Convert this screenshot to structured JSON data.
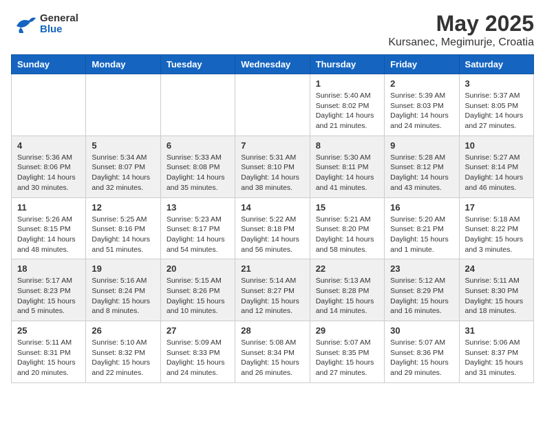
{
  "header": {
    "logo_general": "General",
    "logo_blue": "Blue",
    "title": "May 2025",
    "subtitle": "Kursanec, Megimurje, Croatia"
  },
  "weekdays": [
    "Sunday",
    "Monday",
    "Tuesday",
    "Wednesday",
    "Thursday",
    "Friday",
    "Saturday"
  ],
  "weeks": [
    [
      {
        "day": "",
        "info": ""
      },
      {
        "day": "",
        "info": ""
      },
      {
        "day": "",
        "info": ""
      },
      {
        "day": "",
        "info": ""
      },
      {
        "day": "1",
        "info": "Sunrise: 5:40 AM\nSunset: 8:02 PM\nDaylight: 14 hours\nand 21 minutes."
      },
      {
        "day": "2",
        "info": "Sunrise: 5:39 AM\nSunset: 8:03 PM\nDaylight: 14 hours\nand 24 minutes."
      },
      {
        "day": "3",
        "info": "Sunrise: 5:37 AM\nSunset: 8:05 PM\nDaylight: 14 hours\nand 27 minutes."
      }
    ],
    [
      {
        "day": "4",
        "info": "Sunrise: 5:36 AM\nSunset: 8:06 PM\nDaylight: 14 hours\nand 30 minutes."
      },
      {
        "day": "5",
        "info": "Sunrise: 5:34 AM\nSunset: 8:07 PM\nDaylight: 14 hours\nand 32 minutes."
      },
      {
        "day": "6",
        "info": "Sunrise: 5:33 AM\nSunset: 8:08 PM\nDaylight: 14 hours\nand 35 minutes."
      },
      {
        "day": "7",
        "info": "Sunrise: 5:31 AM\nSunset: 8:10 PM\nDaylight: 14 hours\nand 38 minutes."
      },
      {
        "day": "8",
        "info": "Sunrise: 5:30 AM\nSunset: 8:11 PM\nDaylight: 14 hours\nand 41 minutes."
      },
      {
        "day": "9",
        "info": "Sunrise: 5:28 AM\nSunset: 8:12 PM\nDaylight: 14 hours\nand 43 minutes."
      },
      {
        "day": "10",
        "info": "Sunrise: 5:27 AM\nSunset: 8:14 PM\nDaylight: 14 hours\nand 46 minutes."
      }
    ],
    [
      {
        "day": "11",
        "info": "Sunrise: 5:26 AM\nSunset: 8:15 PM\nDaylight: 14 hours\nand 48 minutes."
      },
      {
        "day": "12",
        "info": "Sunrise: 5:25 AM\nSunset: 8:16 PM\nDaylight: 14 hours\nand 51 minutes."
      },
      {
        "day": "13",
        "info": "Sunrise: 5:23 AM\nSunset: 8:17 PM\nDaylight: 14 hours\nand 54 minutes."
      },
      {
        "day": "14",
        "info": "Sunrise: 5:22 AM\nSunset: 8:18 PM\nDaylight: 14 hours\nand 56 minutes."
      },
      {
        "day": "15",
        "info": "Sunrise: 5:21 AM\nSunset: 8:20 PM\nDaylight: 14 hours\nand 58 minutes."
      },
      {
        "day": "16",
        "info": "Sunrise: 5:20 AM\nSunset: 8:21 PM\nDaylight: 15 hours\nand 1 minute."
      },
      {
        "day": "17",
        "info": "Sunrise: 5:18 AM\nSunset: 8:22 PM\nDaylight: 15 hours\nand 3 minutes."
      }
    ],
    [
      {
        "day": "18",
        "info": "Sunrise: 5:17 AM\nSunset: 8:23 PM\nDaylight: 15 hours\nand 5 minutes."
      },
      {
        "day": "19",
        "info": "Sunrise: 5:16 AM\nSunset: 8:24 PM\nDaylight: 15 hours\nand 8 minutes."
      },
      {
        "day": "20",
        "info": "Sunrise: 5:15 AM\nSunset: 8:26 PM\nDaylight: 15 hours\nand 10 minutes."
      },
      {
        "day": "21",
        "info": "Sunrise: 5:14 AM\nSunset: 8:27 PM\nDaylight: 15 hours\nand 12 minutes."
      },
      {
        "day": "22",
        "info": "Sunrise: 5:13 AM\nSunset: 8:28 PM\nDaylight: 15 hours\nand 14 minutes."
      },
      {
        "day": "23",
        "info": "Sunrise: 5:12 AM\nSunset: 8:29 PM\nDaylight: 15 hours\nand 16 minutes."
      },
      {
        "day": "24",
        "info": "Sunrise: 5:11 AM\nSunset: 8:30 PM\nDaylight: 15 hours\nand 18 minutes."
      }
    ],
    [
      {
        "day": "25",
        "info": "Sunrise: 5:11 AM\nSunset: 8:31 PM\nDaylight: 15 hours\nand 20 minutes."
      },
      {
        "day": "26",
        "info": "Sunrise: 5:10 AM\nSunset: 8:32 PM\nDaylight: 15 hours\nand 22 minutes."
      },
      {
        "day": "27",
        "info": "Sunrise: 5:09 AM\nSunset: 8:33 PM\nDaylight: 15 hours\nand 24 minutes."
      },
      {
        "day": "28",
        "info": "Sunrise: 5:08 AM\nSunset: 8:34 PM\nDaylight: 15 hours\nand 26 minutes."
      },
      {
        "day": "29",
        "info": "Sunrise: 5:07 AM\nSunset: 8:35 PM\nDaylight: 15 hours\nand 27 minutes."
      },
      {
        "day": "30",
        "info": "Sunrise: 5:07 AM\nSunset: 8:36 PM\nDaylight: 15 hours\nand 29 minutes."
      },
      {
        "day": "31",
        "info": "Sunrise: 5:06 AM\nSunset: 8:37 PM\nDaylight: 15 hours\nand 31 minutes."
      }
    ]
  ]
}
